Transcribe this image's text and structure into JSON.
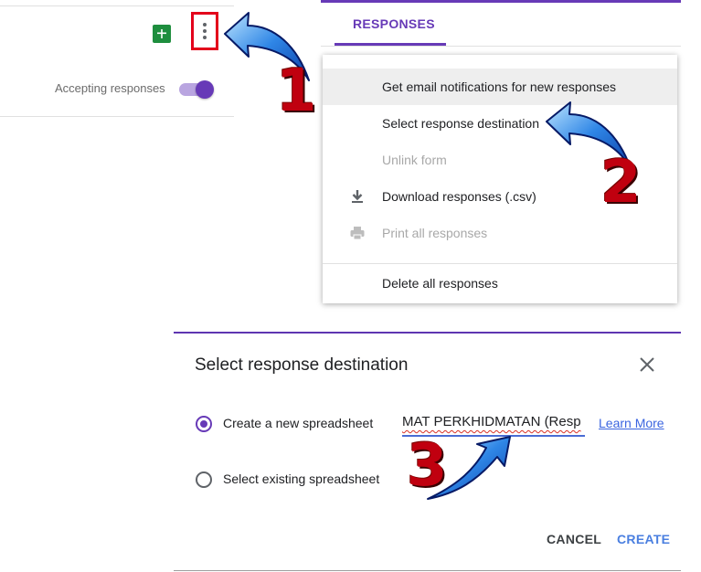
{
  "panel1": {
    "accepting_label": "Accepting responses",
    "toggle_on": true,
    "sheets_icon": "sheets-icon",
    "more_icon": "more-vert-icon"
  },
  "panel2": {
    "tab_label": "RESPONSES",
    "menu_items": [
      {
        "label": "Get email notifications for new responses",
        "icon": "",
        "disabled": false,
        "highlighted": true
      },
      {
        "label": "Select response destination",
        "icon": "",
        "disabled": false,
        "highlighted": false
      },
      {
        "label": "Unlink form",
        "icon": "",
        "disabled": true,
        "highlighted": false
      },
      {
        "label": "Download responses (.csv)",
        "icon": "download-icon",
        "disabled": false,
        "highlighted": false
      },
      {
        "label": "Print all responses",
        "icon": "print-icon",
        "disabled": true,
        "highlighted": false
      },
      {
        "label": "Delete all responses",
        "icon": "",
        "disabled": false,
        "highlighted": false
      }
    ]
  },
  "dialog": {
    "title": "Select response destination",
    "option_new_label": "Create a new spreadsheet",
    "option_existing_label": "Select existing spreadsheet",
    "selected_option": "new",
    "spreadsheet_name_value": "MAT PERKHIDMATAN (Resp",
    "learn_more_label": "Learn More",
    "cancel_label": "CANCEL",
    "create_label": "CREATE",
    "close_icon": "close-icon"
  },
  "annotations": {
    "step1": "1",
    "step2": "2",
    "step3": "3"
  },
  "colors": {
    "accent": "#673ab7",
    "sheets_green": "#1e8e3e",
    "annotation_red": "#c0000f",
    "arrow_blue": "#1f6fd6",
    "link_blue": "#3b65e0"
  }
}
